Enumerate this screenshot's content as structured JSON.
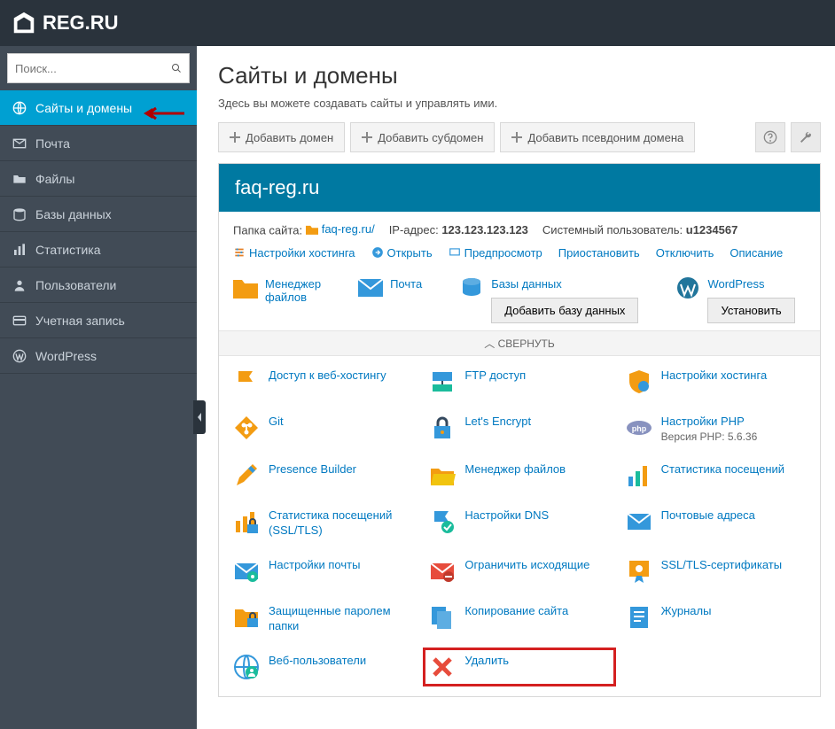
{
  "header": {
    "brand": "REG.RU"
  },
  "search": {
    "placeholder": "Поиск..."
  },
  "sidebar": {
    "items": [
      {
        "label": "Сайты и домены",
        "icon": "globe",
        "active": true
      },
      {
        "label": "Почта",
        "icon": "mail"
      },
      {
        "label": "Файлы",
        "icon": "folder"
      },
      {
        "label": "Базы данных",
        "icon": "database"
      },
      {
        "label": "Статистика",
        "icon": "bars"
      },
      {
        "label": "Пользователи",
        "icon": "user"
      },
      {
        "label": "Учетная запись",
        "icon": "card"
      },
      {
        "label": "WordPress",
        "icon": "wordpress"
      }
    ]
  },
  "page": {
    "title": "Сайты и домены",
    "subtitle": "Здесь вы можете создавать сайты и управлять ими."
  },
  "toolbar": {
    "add_domain": "Добавить домен",
    "add_subdomain": "Добавить субдомен",
    "add_alias": "Добавить псевдоним домена"
  },
  "domain": {
    "name": "faq-reg.ru",
    "folder_label": "Папка сайта:",
    "folder": "faq-reg.ru/",
    "ip_label": "IP-адрес:",
    "ip": "123.123.123.123",
    "sysuser_label": "Системный пользователь:",
    "sysuser": "u1234567",
    "actions": {
      "hosting": "Настройки хостинга",
      "open": "Открыть",
      "preview": "Предпросмотр",
      "suspend": "Приостановить",
      "disable": "Отключить",
      "describe": "Описание"
    }
  },
  "cards": {
    "fm": {
      "label1": "Менеджер",
      "label2": "файлов"
    },
    "mail": {
      "label": "Почта"
    },
    "db": {
      "label": "Базы данных",
      "button": "Добавить базу данных"
    },
    "wp": {
      "label": "WordPress",
      "button": "Установить"
    }
  },
  "collapse": "СВЕРНУТЬ",
  "tiles": [
    {
      "label": "Доступ к веб-хостингу",
      "icon": "flag",
      "color": "orange"
    },
    {
      "label": "FTP доступ",
      "icon": "ftp",
      "color": "blue"
    },
    {
      "label": "Настройки хостинга",
      "icon": "shield",
      "color": "orange"
    },
    {
      "label": "Git",
      "icon": "git",
      "color": "orange"
    },
    {
      "label": "Let's Encrypt",
      "icon": "lock",
      "color": "blue"
    },
    {
      "label": "Настройки PHP",
      "icon": "php",
      "color": "purple",
      "meta": "Версия PHP: 5.6.36"
    },
    {
      "label": "Presence Builder",
      "icon": "pencil",
      "color": "orange"
    },
    {
      "label": "Менеджер файлов",
      "icon": "folderopen",
      "color": "orange"
    },
    {
      "label": "Статистика посещений",
      "icon": "barsup",
      "color": "multi"
    },
    {
      "label": "Статистика посещений (SSL/TLS)",
      "icon": "barslock",
      "color": "orange"
    },
    {
      "label": "Настройки DNS",
      "icon": "dns",
      "color": "blue"
    },
    {
      "label": "Почтовые адреса",
      "icon": "envelope",
      "color": "blue"
    },
    {
      "label": "Настройки почты",
      "icon": "mailgear",
      "color": "blue"
    },
    {
      "label": "Ограничить исходящие",
      "icon": "mailblock",
      "color": "red"
    },
    {
      "label": "SSL/TLS-сертификаты",
      "icon": "cert",
      "color": "orange"
    },
    {
      "label": "Защищенные паролем папки",
      "icon": "folderlock",
      "color": "orange"
    },
    {
      "label": "Копирование сайта",
      "icon": "copy",
      "color": "blue"
    },
    {
      "label": "Журналы",
      "icon": "log",
      "color": "blue"
    },
    {
      "label": "Веб-пользователи",
      "icon": "webuser",
      "color": "blue"
    },
    {
      "label": "Удалить",
      "icon": "delete",
      "color": "red",
      "highlight": true
    }
  ]
}
